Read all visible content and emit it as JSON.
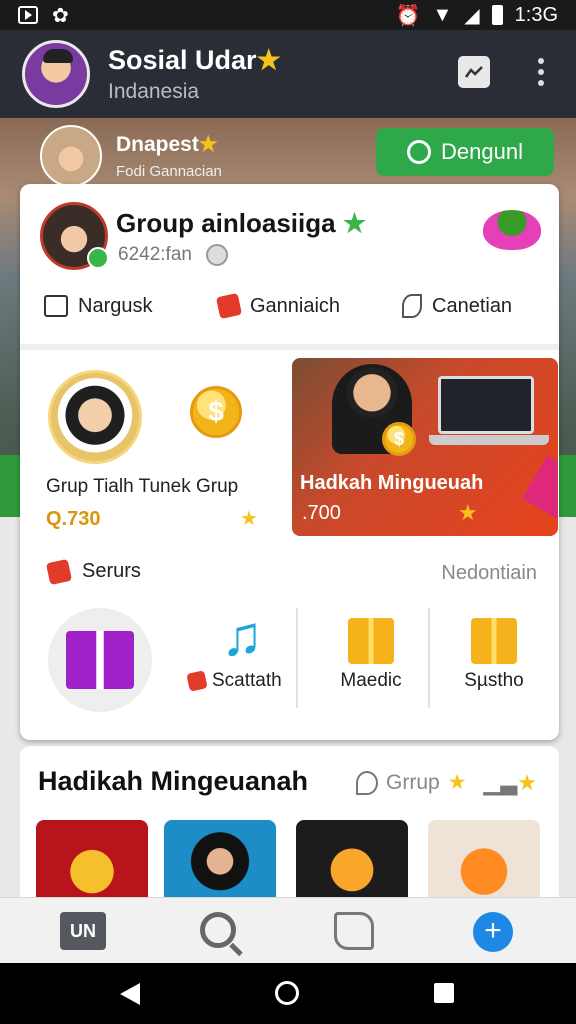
{
  "status_bar": {
    "time": "1:3G"
  },
  "header": {
    "title": "Sosial Udar",
    "subtitle": "Indanesia",
    "title_star": "★"
  },
  "promo": {
    "name": "Dnapest",
    "name_star": "★",
    "caption": "Fodi Gannacian",
    "button_label": "Dengunl"
  },
  "group_card": {
    "title": "Group ainloasiiga",
    "title_star": "★",
    "meta": "6242:fan",
    "tabs": [
      {
        "label": "Nargusk",
        "icon": "document-icon"
      },
      {
        "label": "Ganniaich",
        "icon": "dice-icon"
      },
      {
        "label": "Canetian",
        "icon": "leaf-icon"
      }
    ],
    "items": [
      {
        "label": "Grup Tialh Tunek Grup",
        "price": "Q.730",
        "coin_symbol": "$"
      },
      {
        "label": "Hadkah Mingueuah",
        "price": ".700",
        "coin_symbol": "$"
      }
    ],
    "section_label": "Serurs",
    "section_link": "Nedontiain",
    "categories": [
      {
        "label": "Scattath",
        "icon": "music-note-icon"
      },
      {
        "label": "Maedic",
        "icon": "gift-box-icon"
      },
      {
        "label": "Sµstho",
        "icon": "gift-box-icon"
      }
    ]
  },
  "weekly_card": {
    "title": "Hadikah Mingeuanah",
    "link": "Grrup",
    "link_star": "★"
  },
  "bottom_nav": {
    "item1_label": "UN",
    "add_symbol": "+"
  },
  "colors": {
    "accent_green": "#2fa84a",
    "accent_blue": "#1e88e5",
    "coin_gold": "#f3b41a",
    "feature_red": "#e7421d"
  }
}
